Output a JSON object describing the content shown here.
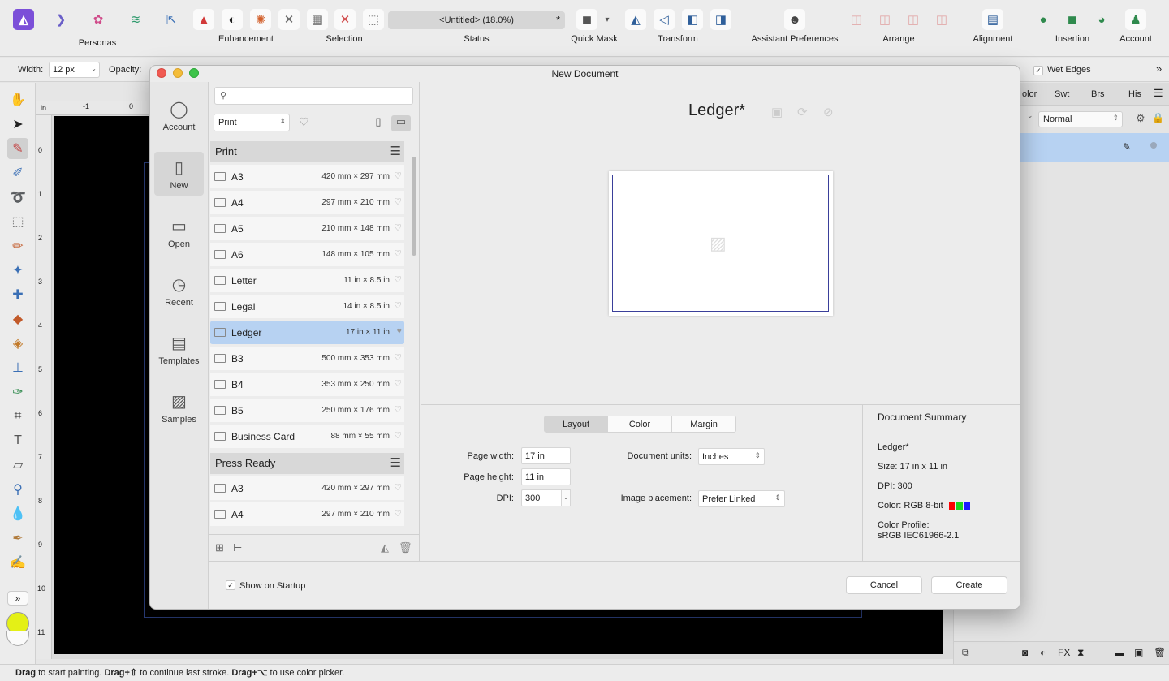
{
  "toolbar": {
    "groups": {
      "personas": "Personas",
      "enhancement": "Enhancement",
      "selection": "Selection",
      "status": "Status",
      "quick_mask": "Quick Mask",
      "transform": "Transform",
      "assistant": "Assistant Preferences",
      "arrange": "Arrange",
      "alignment": "Alignment",
      "insertion": "Insertion",
      "account": "Account"
    },
    "doc_status": "<Untitled> (18.0%)",
    "doc_status_mark": "*"
  },
  "context_bar": {
    "width_label": "Width:",
    "width_value": "12 px",
    "opacity_label": "Opacity:",
    "wet_edges_label": "Wet Edges"
  },
  "ruler": {
    "unit": "in",
    "top_ticks": [
      "-1",
      "0"
    ],
    "left_ticks": [
      "0",
      "1",
      "2",
      "3",
      "4",
      "5",
      "6",
      "7",
      "8",
      "9",
      "10",
      "11"
    ]
  },
  "right_panel": {
    "tabs": [
      "olor",
      "Swt",
      "Brs",
      "His"
    ],
    "blend_mode": "Normal"
  },
  "status_bar": {
    "parts": [
      "Drag",
      " to start painting. ",
      "Drag+⇧",
      " to continue last stroke. ",
      "Drag+⌥",
      " to use color picker."
    ]
  },
  "dialog": {
    "title": "New Document",
    "nav": {
      "account": "Account",
      "new": "New",
      "open": "Open",
      "recent": "Recent",
      "templates": "Templates",
      "samples": "Samples"
    },
    "category": "Print",
    "groups": [
      {
        "name": "Print",
        "items": [
          {
            "name": "A3",
            "dims": "420 mm × 297 mm"
          },
          {
            "name": "A4",
            "dims": "297 mm × 210 mm"
          },
          {
            "name": "A5",
            "dims": "210 mm × 148 mm"
          },
          {
            "name": "A6",
            "dims": "148 mm × 105 mm"
          },
          {
            "name": "Letter",
            "dims": "11 in × 8.5 in"
          },
          {
            "name": "Legal",
            "dims": "14 in × 8.5 in"
          },
          {
            "name": "Ledger",
            "dims": "17 in × 11 in"
          },
          {
            "name": "B3",
            "dims": "500 mm × 353 mm"
          },
          {
            "name": "B4",
            "dims": "353 mm × 250 mm"
          },
          {
            "name": "B5",
            "dims": "250 mm × 176 mm"
          },
          {
            "name": "Business Card",
            "dims": "88 mm × 55 mm"
          }
        ]
      },
      {
        "name": "Press Ready",
        "items": [
          {
            "name": "A3",
            "dims": "420 mm × 297 mm"
          },
          {
            "name": "A4",
            "dims": "297 mm × 210 mm"
          }
        ]
      }
    ],
    "selected_preset": "Ledger",
    "doc_name": "Ledger*",
    "tabs": [
      "Layout",
      "Color",
      "Margin"
    ],
    "active_tab": "Layout",
    "fields": {
      "page_width_label": "Page width:",
      "page_width": "17 in",
      "page_height_label": "Page height:",
      "page_height": "11 in",
      "dpi_label": "DPI:",
      "dpi": "300",
      "units_label": "Document units:",
      "units": "Inches",
      "placement_label": "Image placement:",
      "placement": "Prefer Linked"
    },
    "summary": {
      "title": "Document Summary",
      "name": "Ledger*",
      "size": "Size: 17 in x 11 in",
      "dpi": "DPI:  300",
      "color": "Color: RGB 8-bit",
      "profile_label": "Color Profile:",
      "profile": "sRGB IEC61966-2.1"
    },
    "show_on_startup": "Show on Startup",
    "cancel": "Cancel",
    "create": "Create"
  },
  "colors": {
    "accent_selected": "#b7d2f2",
    "primary_swatch": "#e4f016",
    "preview_border": "#3a3f9a"
  }
}
